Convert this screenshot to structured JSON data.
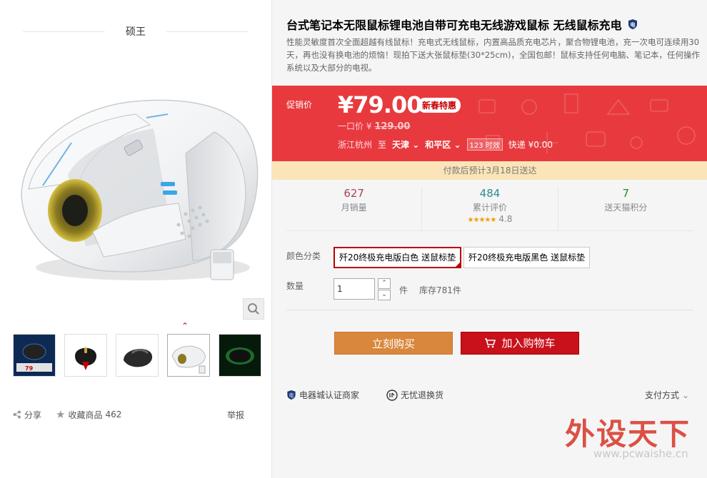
{
  "store": {
    "name": "硕王"
  },
  "gallery": {
    "thumb_badge_price": "79",
    "zoom_icon": "magnifier-icon"
  },
  "actions": {
    "share": "分享",
    "favorite": "收藏商品",
    "favorite_count": "462",
    "report": "举报"
  },
  "product": {
    "title": "台式笔记本无限鼠标锂电池自带可充电无线游戏鼠标 无线鼠标充电",
    "subtitle": "性能灵敏度首次全面超越有线鼠标！充电式无线鼠标，内置高品质充电芯片，聚合物锂电池，充一次电可连续用30天，再也没有换电池的烦恼！现拍下送大张鼠标垫(30*25cm)，全国包邮！鼠标支持任何电脑、笔记本，任何操作系统以及大部分的电视。"
  },
  "price": {
    "promo_label": "促销价",
    "current": "¥79.00",
    "badge": "新春特惠",
    "orig_label": "一口价",
    "orig_currency": "¥",
    "orig_value": "129.00",
    "ship_from": "浙江杭州",
    "ship_to_label": "至",
    "ship_city": "天津",
    "ship_district": "和平区",
    "timely_tag": "123 时效",
    "shipping": "快递 ¥0.00"
  },
  "delivery_note": "付款后预计3月18日送达",
  "stats": {
    "monthly_sales_value": "627",
    "monthly_sales_label": "月销量",
    "reviews_value": "484",
    "reviews_label": "累计评价",
    "rating": "4.8",
    "points_value": "7",
    "points_label": "送天猫积分"
  },
  "options": {
    "color_label": "颜色分类",
    "colors": [
      "歼20终极充电版白色 送鼠标垫",
      "歼20终极充电版黑色 送鼠标垫"
    ],
    "qty_label": "数量",
    "qty_value": "1",
    "qty_unit": "件",
    "stock": "库存781件"
  },
  "buttons": {
    "buy_now": "立刻购买",
    "add_cart": "加入购物车"
  },
  "guarantees": {
    "certified": "电器城认证商家",
    "returns": "无忧退换货",
    "payment": "支付方式"
  },
  "watermark": {
    "text": "外设天下",
    "url": "www.pcwaishe.cn"
  },
  "colors": {
    "price_bg": "#e83a3e",
    "buy_now": "#d9873c",
    "add_cart": "#c8111b",
    "delivery_bg": "#fbe5b8"
  }
}
